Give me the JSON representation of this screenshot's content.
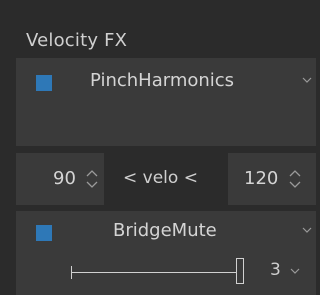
{
  "panel_title": "Velocity FX",
  "effect1": {
    "name": "PinchHarmonics",
    "enabled": true,
    "checkbox_color": "#2e78b7"
  },
  "velocity": {
    "min": "90",
    "max": "120",
    "label": "< velo <"
  },
  "effect2": {
    "name": "BridgeMute",
    "enabled": true,
    "checkbox_color": "#2e78b7",
    "amount": "3",
    "slider_level": 1.0
  },
  "icons": {
    "dropdown": "chevron-down-icon",
    "spinner": "spinner-updown-icon"
  }
}
